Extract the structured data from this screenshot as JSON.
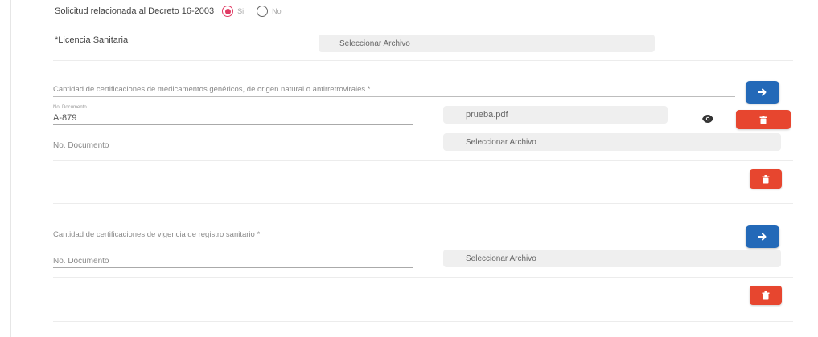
{
  "decreto": {
    "question": "Solicitud relacionada al Decreto 16-2003",
    "options": [
      {
        "label": "Si",
        "selected": true
      },
      {
        "label": "No",
        "selected": false
      }
    ]
  },
  "licencia": {
    "label": "*Licencia Sanitaria",
    "file_button": "Seleccionar Archivo"
  },
  "section1": {
    "title": "Cantidad de certificaciones de medicamentos genéricos, de origen natural o antirretrovirales *",
    "entry": {
      "doc_small_label": "No. Documento",
      "doc_value": "A-879",
      "file_name": "prueba.pdf"
    },
    "new_row": {
      "doc_placeholder": "No. Documento",
      "file_button": "Seleccionar Archivo"
    }
  },
  "section2": {
    "title": "Cantidad de certificaciones de vigencia de registro sanitario *",
    "new_row": {
      "doc_placeholder": "No. Documento",
      "file_button": "Seleccionar Archivo"
    }
  },
  "colors": {
    "radio_selected": "#e03a63",
    "button_blue": "#2369b8",
    "button_red": "#e7462f"
  },
  "icons": [
    "arrow-right-icon",
    "trash-icon",
    "eye-icon"
  ]
}
